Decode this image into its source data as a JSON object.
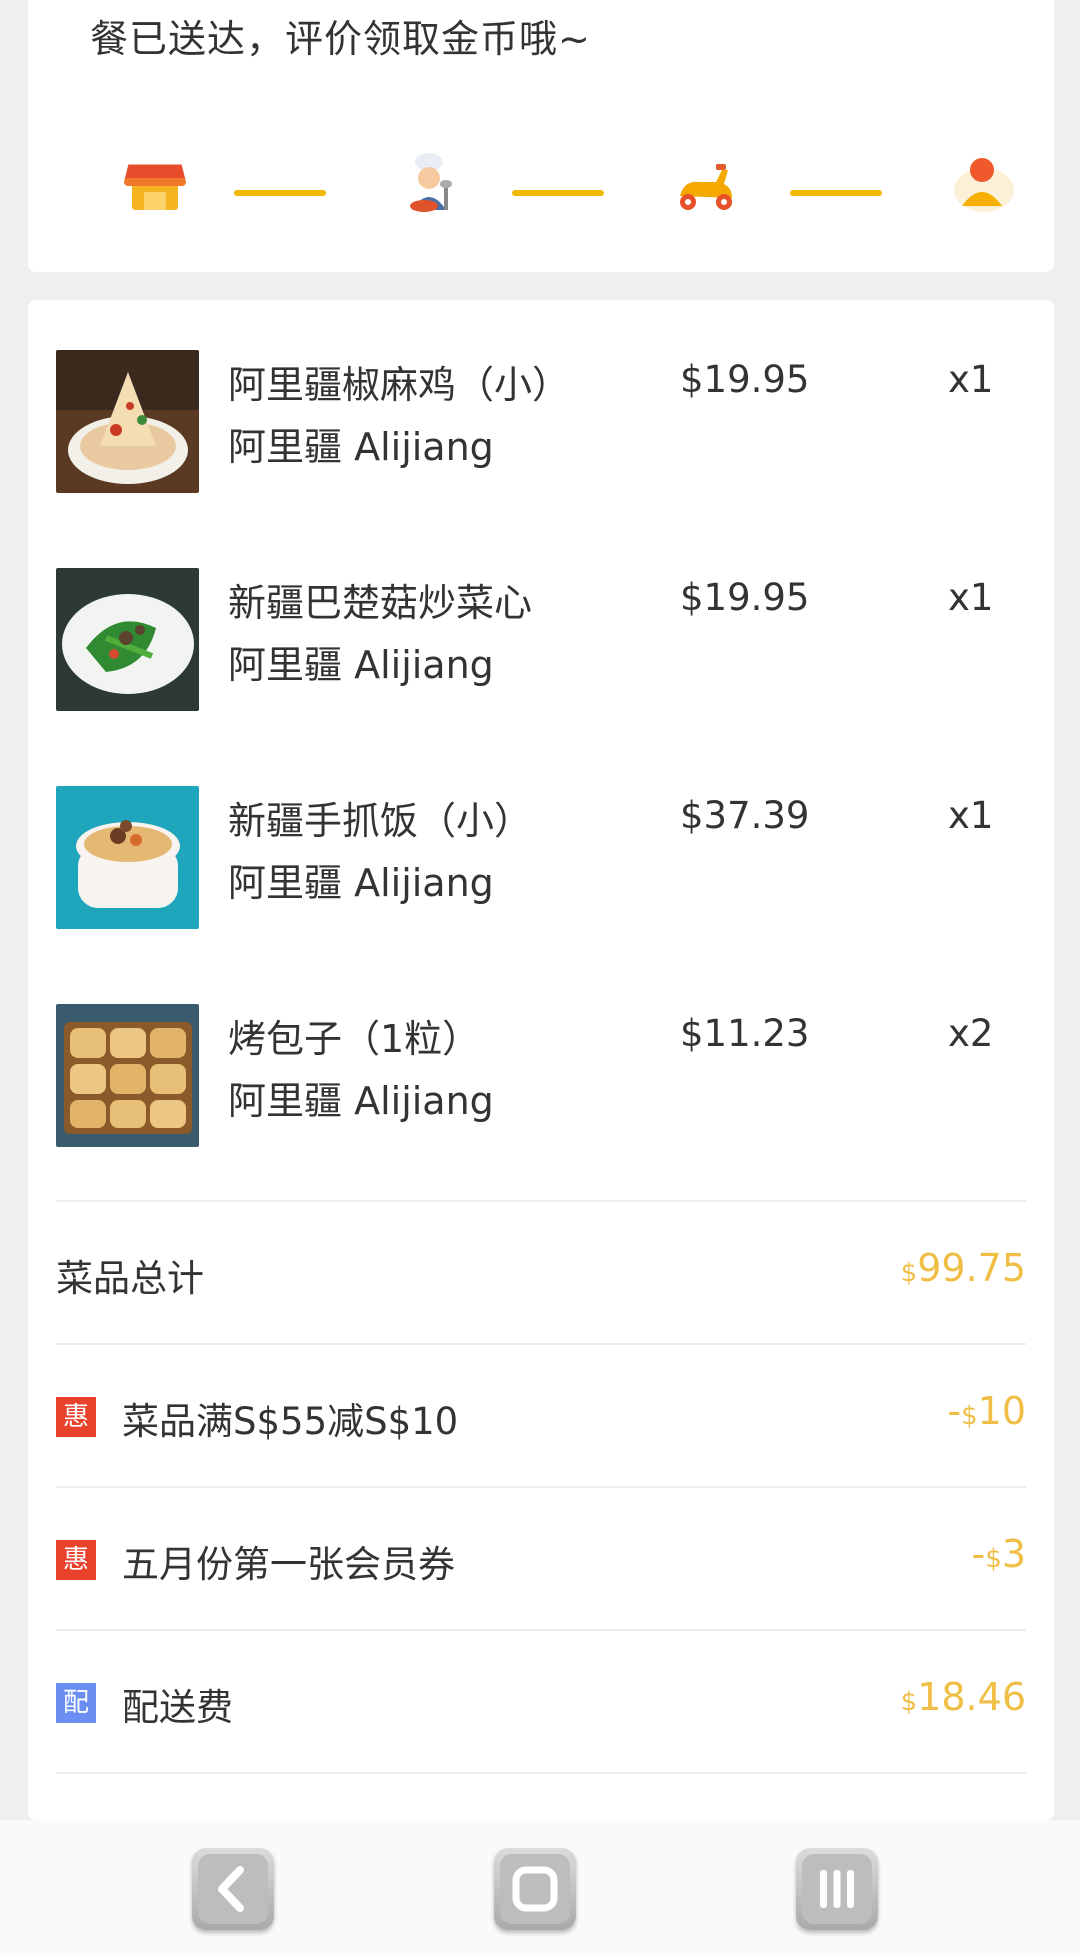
{
  "status": {
    "message": "餐已送达，评价领取金币哦~"
  },
  "progress_steps": [
    {
      "icon": "store-icon"
    },
    {
      "icon": "chef-icon"
    },
    {
      "icon": "scooter-icon"
    },
    {
      "icon": "customer-icon"
    }
  ],
  "items": [
    {
      "name": "阿里疆椒麻鸡（小）",
      "shop": "阿里疆 Alijiang",
      "price": "$19.95",
      "qty": "x1",
      "thumb": "spicy-chicken-dish"
    },
    {
      "name": "新疆巴楚菇炒菜心",
      "shop": "阿里疆 Alijiang",
      "price": "$19.95",
      "qty": "x1",
      "thumb": "stir-fried-greens-dish"
    },
    {
      "name": "新疆手抓饭（小）",
      "shop": "阿里疆 Alijiang",
      "price": "$37.39",
      "qty": "x1",
      "thumb": "pilaf-rice-pot"
    },
    {
      "name": "烤包子（1粒）",
      "shop": "阿里疆 Alijiang",
      "price": "$11.23",
      "qty": "x2",
      "thumb": "baked-buns-tray"
    }
  ],
  "summary": {
    "subtotal": {
      "label": "菜品总计",
      "currency": "$",
      "value": "99.75"
    },
    "discount1": {
      "badge": "惠",
      "label": "菜品满S$55减S$10",
      "prefix": "-",
      "currency": "$",
      "value": "10"
    },
    "discount2": {
      "badge": "惠",
      "label": "五月份第一张会员券",
      "prefix": "-",
      "currency": "$",
      "value": "3"
    },
    "delivery": {
      "badge": "配",
      "label": "配送费",
      "currency": "$",
      "value": "18.46"
    }
  },
  "colors": {
    "accent": "#f0b800",
    "price_highlight": "#f0be46",
    "badge_red": "#e8412c",
    "badge_blue": "#6a8ef2"
  },
  "system_nav": {
    "buttons": [
      "back-icon",
      "home-icon",
      "recents-icon"
    ]
  }
}
